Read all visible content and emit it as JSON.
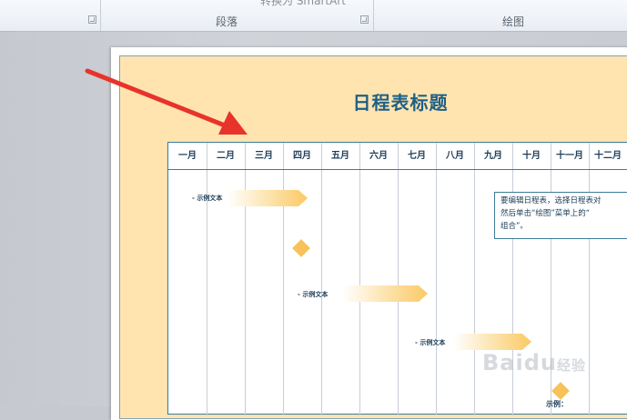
{
  "ribbon": {
    "cut_text": "转换为 SmartArt",
    "groups": [
      {
        "label": "段落"
      },
      {
        "label": "绘图"
      }
    ]
  },
  "slide": {
    "title": "日程表标题",
    "months": [
      "一月",
      "二月",
      "三月",
      "四月",
      "五月",
      "六月",
      "七月",
      "八月",
      "九月",
      "十月",
      "十一月",
      "十二月"
    ],
    "tasks": [
      {
        "label": "- 示例文本"
      },
      {
        "label": "- 示例文本"
      },
      {
        "label": "- 示例文本"
      }
    ],
    "note_lines": [
      "要编辑日程表，选择日程表对",
      "然后单击“绘图”菜单上的“",
      "组合”。"
    ],
    "bottom_label": "示例："
  },
  "watermark": {
    "text": "Baidu",
    "suffix": "经验"
  },
  "colors": {
    "slide_background": "#ffe4b0",
    "title": "#1f5f85",
    "bar_gradient_end": "#fbc964",
    "milestone": "#f7c25a",
    "arrow": "#e8332a"
  }
}
